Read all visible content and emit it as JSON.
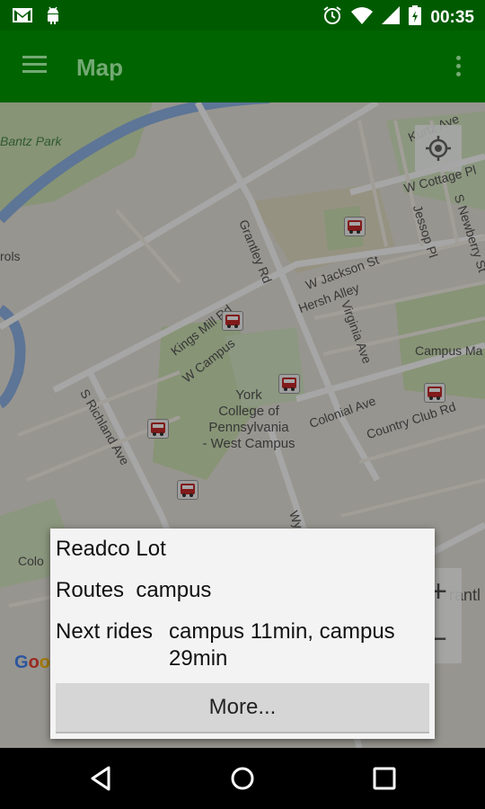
{
  "status_bar": {
    "time": "00:35",
    "left_icons": [
      "gmail-icon",
      "android-debug-icon"
    ],
    "right_icons": [
      "alarm-icon",
      "wifi-icon",
      "signal-icon",
      "battery-icon"
    ]
  },
  "app_bar": {
    "title": "Map",
    "color": "#006400"
  },
  "map": {
    "labels": {
      "bantz_park": "Bantz Park",
      "rols": "rols",
      "kurtz_ave": "Kurtz Ave",
      "w_cottage_pl": "W Cottage Pl",
      "jessop_pl": "Jessop Pl",
      "s_newberry_st": "S Newberry St",
      "grantley_rd": "Grantley Rd",
      "w_jackson_st": "W Jackson St",
      "hersh_alley": "Hersh Alley",
      "kings_mill_rd": "Kings Mill Rd",
      "w_campus_dr": "W Campus",
      "virginia_ave": "Virginia Ave",
      "campus_ma": "Campus Ma",
      "s_richland_ave": "S Richland Ave",
      "campus_name_1": "York",
      "campus_name_2": "College of",
      "campus_name_3": "Pennsylvania",
      "campus_name_4": "- West Campus",
      "colonial_ave": "Colonial Ave",
      "country_club_rd": "Country Club Rd",
      "colo": "Colo",
      "wy": "Wy",
      "rantl": "rantl"
    },
    "google_logo": "Goo"
  },
  "dialog": {
    "stop_name": "Readco Lot",
    "routes_label": "Routes",
    "routes_value": "campus",
    "next_label": "Next rides",
    "next_value": "campus 11min, campus 29min",
    "more_button": "More..."
  }
}
